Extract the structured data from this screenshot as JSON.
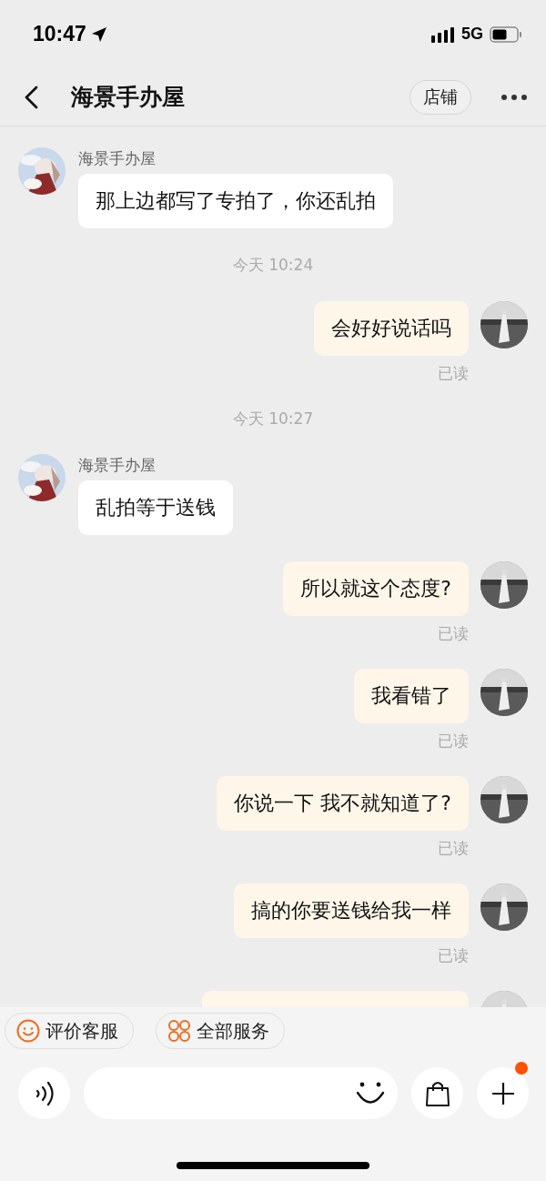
{
  "status_bar": {
    "time": "10:47",
    "network": "5G"
  },
  "header": {
    "title": "海景手办屋",
    "shop_button": "店铺"
  },
  "messages": [
    {
      "kind": "incoming",
      "sender": "海景手办屋",
      "text": "那上边都写了专拍了，你还乱拍"
    },
    {
      "kind": "time",
      "text": "今天 10:24"
    },
    {
      "kind": "outgoing",
      "text": "会好好说话吗",
      "receipt": "已读"
    },
    {
      "kind": "time",
      "text": "今天 10:27"
    },
    {
      "kind": "incoming",
      "sender": "海景手办屋",
      "text": "乱拍等于送钱"
    },
    {
      "kind": "outgoing",
      "text": "所以就这个态度?",
      "receipt": "已读"
    },
    {
      "kind": "outgoing",
      "text": "我看错了",
      "receipt": "已读"
    },
    {
      "kind": "outgoing",
      "text": "你说一下 我不就知道了?",
      "receipt": "已读"
    },
    {
      "kind": "outgoing",
      "text": "搞的你要送钱给我一样",
      "receipt": "已读"
    },
    {
      "kind": "cut_off"
    }
  ],
  "quick_actions": [
    {
      "kind": "rate",
      "label": "评价客服"
    },
    {
      "kind": "services",
      "label": "全部服务"
    }
  ],
  "input_bar": {
    "plus_badge": true
  }
}
